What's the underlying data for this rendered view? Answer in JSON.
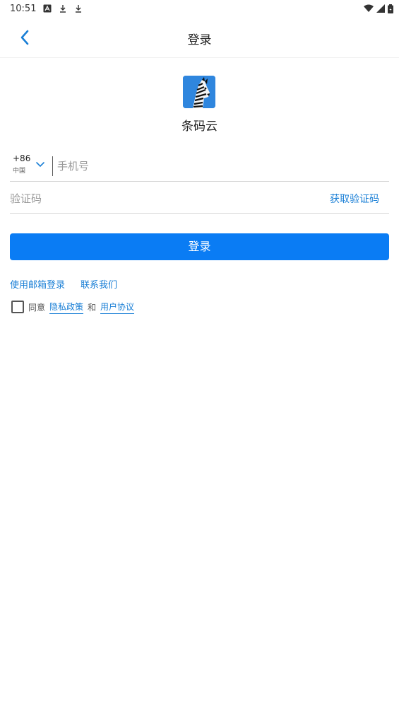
{
  "status_bar": {
    "time": "10:51",
    "icons_left": [
      "a-icon",
      "download-icon",
      "download-icon"
    ],
    "icons_right": [
      "wifi-icon",
      "signal-icon",
      "battery-icon"
    ]
  },
  "header": {
    "title": "登录",
    "back_icon": "chevron-left-icon"
  },
  "app": {
    "name": "条码云",
    "logo_icon": "zebra-icon"
  },
  "form": {
    "country_code": "+86",
    "country_name": "中国",
    "phone_placeholder": "手机号",
    "code_placeholder": "验证码",
    "get_code_label": "获取验证码",
    "login_label": "登录"
  },
  "links": {
    "email_login": "使用邮箱登录",
    "contact_us": "联系我们"
  },
  "agreement": {
    "prefix": "同意",
    "privacy_policy": "隐私政策",
    "and": "和",
    "user_agreement": "用户协议"
  },
  "colors": {
    "accent": "#0a7cf4",
    "link": "#1a7fd6",
    "logo_bg": "#2f86de"
  }
}
